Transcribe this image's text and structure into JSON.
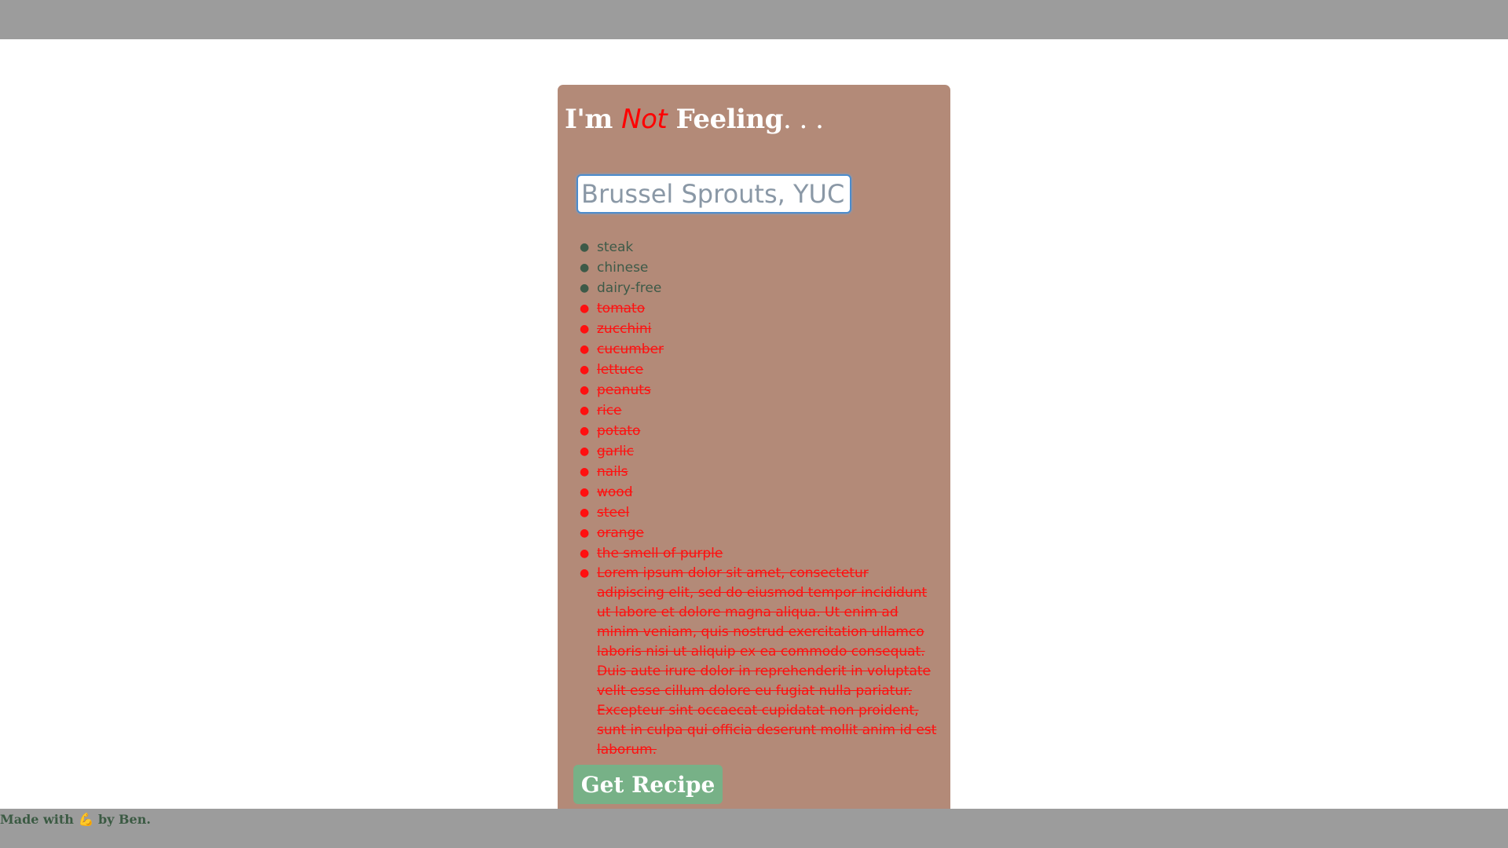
{
  "header": {
    "title_prefix": "I'm ",
    "title_emphasis": "Not",
    "title_suffix": " Feeling",
    "title_dots": ". . ."
  },
  "search": {
    "placeholder": "Brussel Sprouts, YUCK",
    "value": ""
  },
  "food_list": {
    "liked": [
      "steak",
      "chinese",
      "dairy-free"
    ],
    "disliked": [
      "tomato",
      "zucchini",
      "cucumber",
      "lettuce",
      "peanuts",
      "rice",
      "potato",
      "garlic",
      "nails",
      "wood",
      "steel",
      "orange",
      "the smell of purple",
      "Lorem ipsum dolor sit amet, consectetur adipiscing elit, sed do eiusmod tempor incididunt ut labore et dolore magna aliqua. Ut enim ad minim veniam, quis nostrud exercitation ullamco laboris nisi ut aliquip ex ea commodo consequat. Duis aute irure dolor in reprehenderit in voluptate velit esse cillum dolore eu fugiat nulla pariatur. Excepteur sint occaecat cupidatat non proident, sunt in culpa qui officia deserunt mollit anim id est laborum."
    ]
  },
  "button": {
    "label": "Get Recipe"
  },
  "footer": {
    "made_with": "Made with",
    "emoji": "💪",
    "by": "by Ben."
  },
  "colors": {
    "card_background": "#b38a78",
    "liked_text": "#3d5a48",
    "disliked_text": "#ff1010",
    "button": "#77b187",
    "bars": "#9c9c9c"
  }
}
